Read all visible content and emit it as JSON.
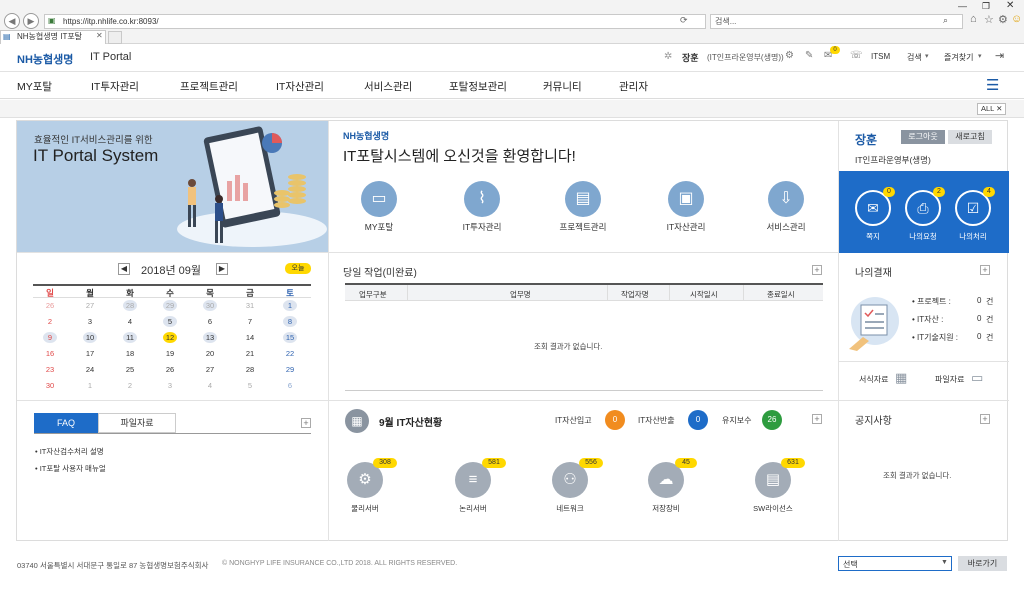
{
  "browser": {
    "url": "https://itp.nhlife.co.kr:8093/",
    "search_placeholder": "검색...",
    "tab_title": "NH농협생명 IT포탈"
  },
  "header": {
    "logo": "NH농협생명",
    "portal": "IT Portal",
    "user": "장훈",
    "dept": "(IT인프라운영부(생명))",
    "notice_count": "0",
    "itsm": "ITSM",
    "search": "검색",
    "favorites": "즐겨찾기"
  },
  "gnb": [
    "MY포탈",
    "IT투자관리",
    "프로젝트관리",
    "IT자산관리",
    "서비스관리",
    "포탈정보관리",
    "커뮤니티",
    "관리자"
  ],
  "all_label": "ALL",
  "hero": {
    "small": "효율적인 IT서비스관리를 위한",
    "big": "IT Portal System"
  },
  "welcome": {
    "logo": "NH농협생명",
    "title": "IT포탈시스템에 오신것을 환영합니다!",
    "items": [
      "MY포탈",
      "IT투자관리",
      "프로젝트관리",
      "IT자산관리",
      "서비스관리"
    ]
  },
  "userbox": {
    "name": "장훈",
    "logout": "로그아웃",
    "refresh": "새로고침",
    "dept": "IT인프라운영부(생명)",
    "stats": [
      {
        "label": "쪽지",
        "count": "0"
      },
      {
        "label": "나의요청",
        "count": "2"
      },
      {
        "label": "나의처리",
        "count": "4"
      }
    ]
  },
  "calendar": {
    "title": "2018년 09월",
    "today": "오늘",
    "weekdays": [
      "일",
      "월",
      "화",
      "수",
      "목",
      "금",
      "토"
    ],
    "rows": [
      [
        "26",
        "27",
        "28",
        "29",
        "30",
        "31",
        "1"
      ],
      [
        "2",
        "3",
        "4",
        "5",
        "6",
        "7",
        "8"
      ],
      [
        "9",
        "10",
        "11",
        "12",
        "13",
        "14",
        "15"
      ],
      [
        "16",
        "17",
        "18",
        "19",
        "20",
        "21",
        "22"
      ],
      [
        "23",
        "24",
        "25",
        "26",
        "27",
        "28",
        "29"
      ],
      [
        "30",
        "1",
        "2",
        "3",
        "4",
        "5",
        "6"
      ]
    ]
  },
  "tasks": {
    "title": "당일 작업(미완료)",
    "columns": [
      "업무구분",
      "업무명",
      "작업자명",
      "시작일시",
      "종료일시"
    ],
    "empty": "조회 결과가 없습니다."
  },
  "approval": {
    "title": "나의결재",
    "rows": [
      {
        "label": "• 프로젝트 :",
        "value": "0",
        "unit": "건"
      },
      {
        "label": "• IT자산 :",
        "value": "0",
        "unit": "건"
      },
      {
        "label": "• IT기술지원 :",
        "value": "0",
        "unit": "건"
      }
    ],
    "docs": "서식자료",
    "files": "파일자료"
  },
  "faq": {
    "tab1": "FAQ",
    "tab2": "파일자료",
    "items": [
      "IT자산검수처리 설명",
      "IT포탈 사용자 매뉴얼"
    ]
  },
  "assets": {
    "title": "9월 IT자산현황",
    "in_label": "IT자산입고",
    "in_val": "0",
    "out_label": "IT자산반출",
    "out_val": "0",
    "maint_label": "유지보수",
    "maint_val": "26",
    "items": [
      {
        "label": "물리서버",
        "count": "308"
      },
      {
        "label": "논리서버",
        "count": "581"
      },
      {
        "label": "네트워크",
        "count": "556"
      },
      {
        "label": "저장장비",
        "count": "45"
      },
      {
        "label": "SW라이선스",
        "count": "631"
      }
    ]
  },
  "notice": {
    "title": "공지사항",
    "empty": "조회 결과가 없습니다."
  },
  "footer": {
    "address": "03740  서울특별시 서대문구 통일로 87 농협생명보험주식회사",
    "copyright": "© NONGHYP LIFE INSURANCE CO.,LTD 2018.  ALL RIGHTS RESERVED.",
    "select": "선택",
    "go": "바로가기"
  }
}
